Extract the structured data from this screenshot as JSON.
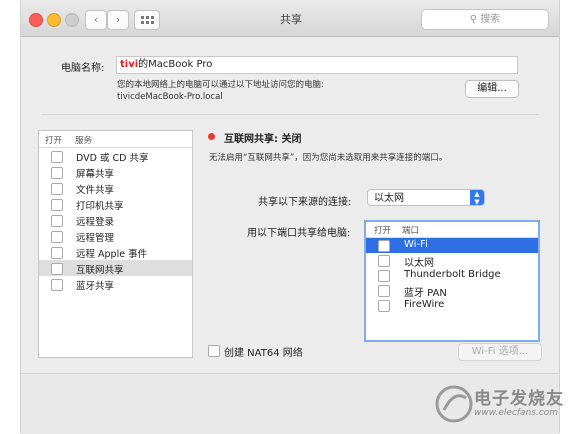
{
  "window": {
    "title": "共享"
  },
  "toolbar": {
    "search_placeholder": "搜索"
  },
  "computer_name": {
    "label": "电脑名称:",
    "redacted_prefix": "tivi",
    "value": "的MacBook Pro",
    "hint_line1": "您的本地网络上的电脑可以通过以下地址访问您的电脑:",
    "hint_line2": "tivicdeMacBook-Pro.local",
    "edit_button": "编辑..."
  },
  "services": {
    "header_on": "打开",
    "header_service": "服务",
    "items": [
      {
        "label": "DVD 或 CD 共享",
        "selected": false
      },
      {
        "label": "屏幕共享",
        "selected": false
      },
      {
        "label": "文件共享",
        "selected": false
      },
      {
        "label": "打印机共享",
        "selected": false
      },
      {
        "label": "远程登录",
        "selected": false
      },
      {
        "label": "远程管理",
        "selected": false
      },
      {
        "label": "远程 Apple 事件",
        "selected": false
      },
      {
        "label": "互联网共享",
        "selected": true
      },
      {
        "label": "蓝牙共享",
        "selected": false
      }
    ]
  },
  "detail": {
    "status": "互联网共享: 关闭",
    "status_color": "#e83a30",
    "description": "无法启用“互联网共享”，因为您尚未选取用来共享连接的端口。",
    "share_from_label": "共享以下来源的连接:",
    "share_from_value": "以太网",
    "share_to_label": "用以下端口共享给电脑:",
    "ports_header_on": "打开",
    "ports_header_port": "端口",
    "ports": [
      {
        "label": "Wi-Fi",
        "selected": true
      },
      {
        "label": "以太网",
        "selected": false
      },
      {
        "label": "Thunderbolt Bridge",
        "selected": false
      },
      {
        "label": "蓝牙 PAN",
        "selected": false
      },
      {
        "label": "FireWire",
        "selected": false
      }
    ],
    "nat64_label": "创建 NAT64 网络",
    "wifi_options_button": "Wi-Fi 选项..."
  },
  "watermark": {
    "text": "电子发烧友",
    "url": "www.elecfans.com"
  },
  "colors": {
    "accent": "#2f6fe6",
    "status_off": "#e83a30"
  }
}
